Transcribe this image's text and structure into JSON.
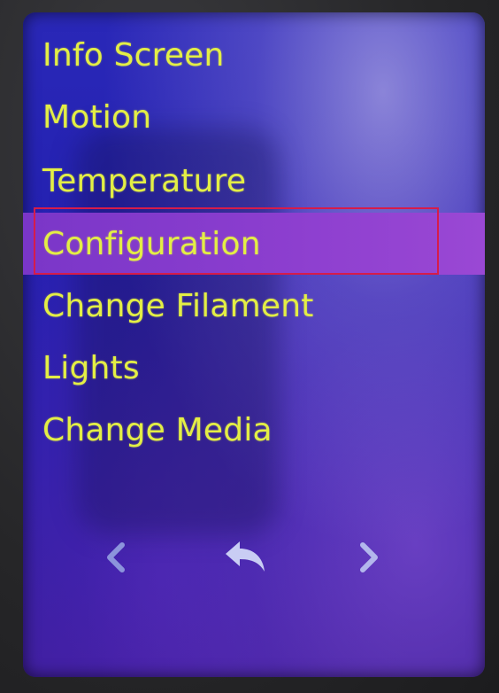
{
  "menu": {
    "items": [
      {
        "label": "Info Screen",
        "selected": false
      },
      {
        "label": "Motion",
        "selected": false
      },
      {
        "label": "Temperature",
        "selected": false
      },
      {
        "label": "Configuration",
        "selected": true
      },
      {
        "label": "Change Filament",
        "selected": false
      },
      {
        "label": "Lights",
        "selected": false
      },
      {
        "label": "Change Media",
        "selected": false
      }
    ]
  },
  "nav": {
    "prev_icon": "chevron-left-icon",
    "back_icon": "back-arrow-icon",
    "next_icon": "chevron-right-icon"
  },
  "colors": {
    "text": "#e3ee45",
    "selected_bg": "#8a3dce",
    "highlight_box": "#d61c4a",
    "screen_bg": "#2320b0"
  }
}
